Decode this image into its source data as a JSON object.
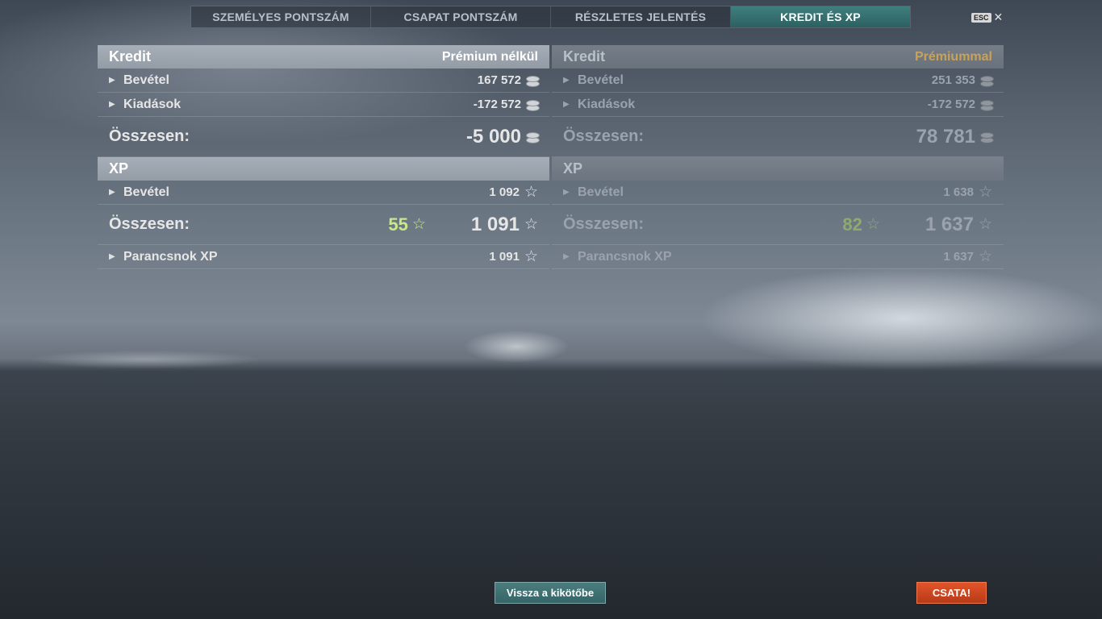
{
  "tabs": [
    {
      "label": "SZEMÉLYES PONTSZÁM"
    },
    {
      "label": "CSAPAT PONTSZÁM"
    },
    {
      "label": "RÉSZLETES JELENTÉS"
    },
    {
      "label": "KREDIT ÉS XP",
      "active": true
    }
  ],
  "esc": {
    "key": "ESC",
    "close_glyph": "✕"
  },
  "left": {
    "credit_header": "Kredit",
    "mode_label": "Prémium nélkül",
    "credit_rows": [
      {
        "label": "Bevétel",
        "value": "167 572",
        "icon": "coin-icon"
      },
      {
        "label": "Kiadások",
        "value": "-172 572",
        "icon": "coin-icon"
      }
    ],
    "credit_total": {
      "label": "Összesen:",
      "value": "-5 000"
    },
    "xp_header": "XP",
    "xp_row": {
      "label": "Bevétel",
      "value": "1 092",
      "icon": "star-icon"
    },
    "xp_total": {
      "label": "Összesen:",
      "bonus": "55",
      "value": "1 091"
    },
    "commander_row": {
      "label": "Parancsnok XP",
      "value": "1 091",
      "icon": "star-icon"
    }
  },
  "right": {
    "credit_header": "Kredit",
    "mode_label": "Prémiummal",
    "credit_rows": [
      {
        "label": "Bevétel",
        "value": "251 353",
        "icon": "coin-icon"
      },
      {
        "label": "Kiadások",
        "value": "-172 572",
        "icon": "coin-icon"
      }
    ],
    "credit_total": {
      "label": "Összesen:",
      "value": "78 781"
    },
    "xp_header": "XP",
    "xp_row": {
      "label": "Bevétel",
      "value": "1 638",
      "icon": "star-icon"
    },
    "xp_total": {
      "label": "Összesen:",
      "bonus": "82",
      "value": "1 637"
    },
    "commander_row": {
      "label": "Parancsnok XP",
      "value": "1 637",
      "icon": "star-icon"
    }
  },
  "buttons": {
    "back": "Vissza a kikötőbe",
    "battle": "CSATA!"
  },
  "colors": {
    "active_tab": "#3f7f7e",
    "premium": "#c9a25a",
    "bonus_xp": "#c8e88a",
    "battle_button": "#d24a22"
  },
  "glyphs": {
    "arrow": "▶",
    "star": "☆"
  }
}
